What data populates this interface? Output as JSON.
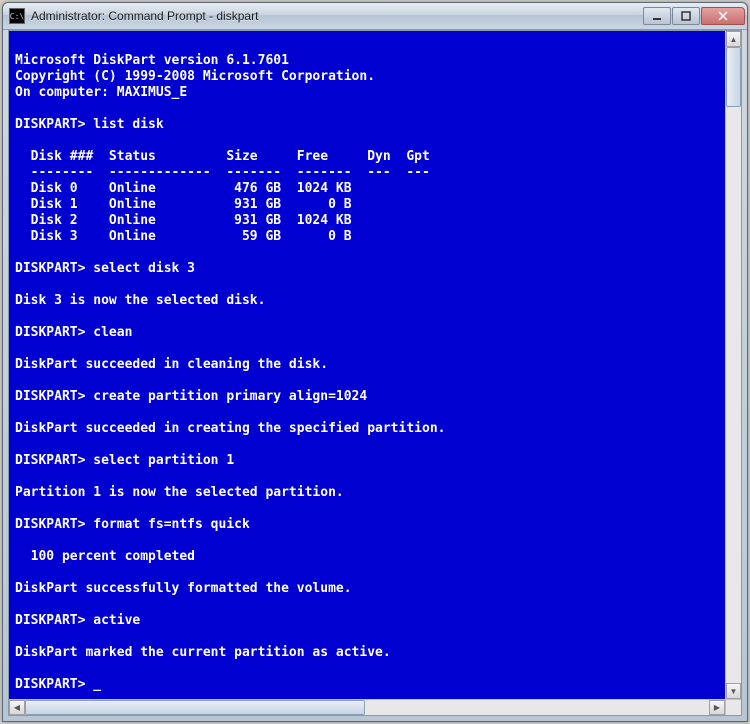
{
  "window": {
    "title": "Administrator: Command Prompt - diskpart",
    "icon_label": "C:\\"
  },
  "console": {
    "header_version": "Microsoft DiskPart version 6.1.7601",
    "header_copyright": "Copyright (C) 1999-2008 Microsoft Corporation.",
    "header_computer": "On computer: MAXIMUS_E",
    "prompt": "DISKPART>",
    "commands": {
      "list_disk": "list disk",
      "select_disk_3": "select disk 3",
      "clean": "clean",
      "create_partition": "create partition primary align=1024",
      "select_partition_1": "select partition 1",
      "format": "format fs=ntfs quick",
      "active": "active"
    },
    "responses": {
      "disk3_selected": "Disk 3 is now the selected disk.",
      "clean_success": "DiskPart succeeded in cleaning the disk.",
      "create_success": "DiskPart succeeded in creating the specified partition.",
      "partition1_selected": "Partition 1 is now the selected partition.",
      "format_progress": "  100 percent completed",
      "format_success": "DiskPart successfully formatted the volume.",
      "active_success": "DiskPart marked the current partition as active."
    },
    "disk_table": {
      "header_row": "  Disk ###  Status         Size     Free     Dyn  Gpt",
      "divider_row": "  --------  -------------  -------  -------  ---  ---",
      "rows": [
        "  Disk 0    Online          476 GB  1024 KB",
        "  Disk 1    Online          931 GB      0 B",
        "  Disk 2    Online          931 GB  1024 KB",
        "  Disk 3    Online           59 GB      0 B"
      ]
    },
    "cursor": "_"
  }
}
